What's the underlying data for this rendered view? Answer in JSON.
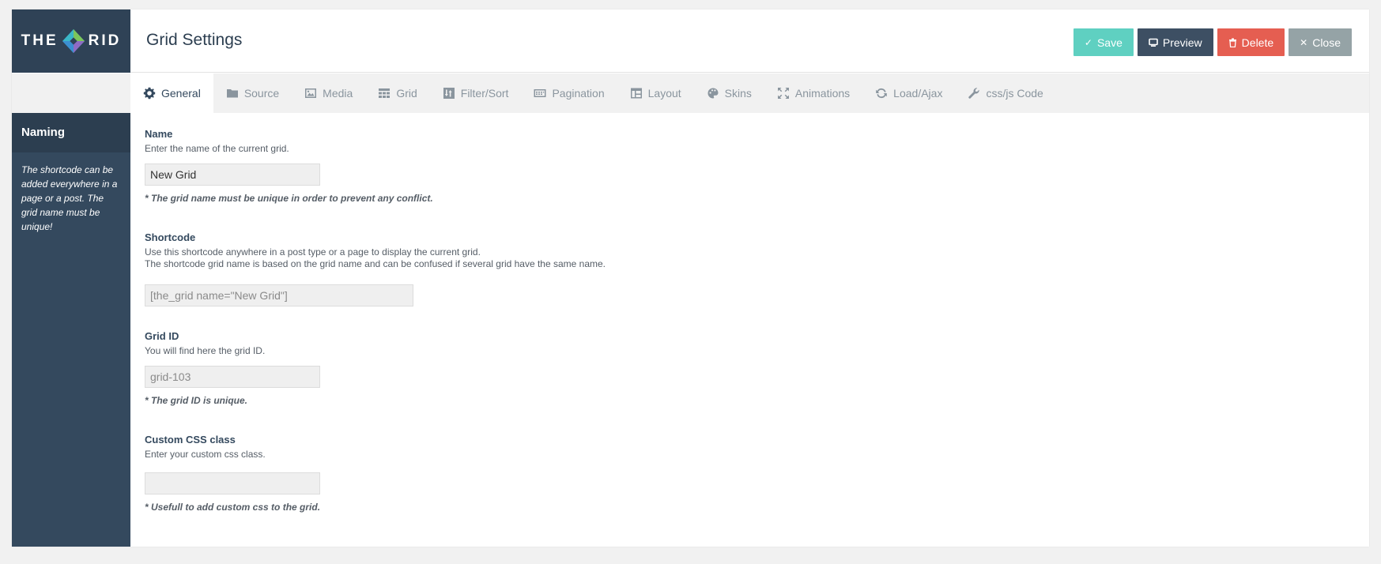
{
  "app": {
    "logo_left": "THE",
    "logo_right": "RID",
    "title": "Grid Settings"
  },
  "actions": {
    "save": "Save",
    "preview": "Preview",
    "delete": "Delete",
    "close": "Close"
  },
  "tabs": [
    {
      "label": "General",
      "icon": "gear-icon"
    },
    {
      "label": "Source",
      "icon": "folder-icon"
    },
    {
      "label": "Media",
      "icon": "image-icon"
    },
    {
      "label": "Grid",
      "icon": "grid-icon"
    },
    {
      "label": "Filter/Sort",
      "icon": "filter-icon"
    },
    {
      "label": "Pagination",
      "icon": "pagination-icon"
    },
    {
      "label": "Layout",
      "icon": "layout-icon"
    },
    {
      "label": "Skins",
      "icon": "palette-icon"
    },
    {
      "label": "Animations",
      "icon": "expand-icon"
    },
    {
      "label": "Load/Ajax",
      "icon": "refresh-icon"
    },
    {
      "label": "css/js Code",
      "icon": "wrench-icon"
    }
  ],
  "active_tab": "General",
  "side": {
    "title": "Naming",
    "description": "The shortcode can be added everywhere in a page or a post. The grid name must be unique!"
  },
  "fields": {
    "name": {
      "label": "Name",
      "desc": "Enter the name of the current grid.",
      "value": "New Grid",
      "note": "* The grid name must be unique in order to prevent any conflict."
    },
    "shortcode": {
      "label": "Shortcode",
      "desc1": "Use this shortcode anywhere in a post type or a page to display the current grid.",
      "desc2": "The shortcode grid name is based on the grid name and can be confused if several grid have the same name.",
      "value": "[the_grid name=\"New Grid\"]"
    },
    "grid_id": {
      "label": "Grid ID",
      "desc": "You will find here the grid ID.",
      "value": "grid-103",
      "note": "* The grid ID is unique."
    },
    "css_class": {
      "label": "Custom CSS class",
      "desc": "Enter your custom css class.",
      "value": "",
      "note": "* Usefull to add custom css to the grid."
    }
  },
  "colors": {
    "sidebar": "#34495e",
    "save": "#5fd0c1",
    "preview": "#3d4f63",
    "delete": "#e55e51",
    "close": "#95a3a6"
  }
}
